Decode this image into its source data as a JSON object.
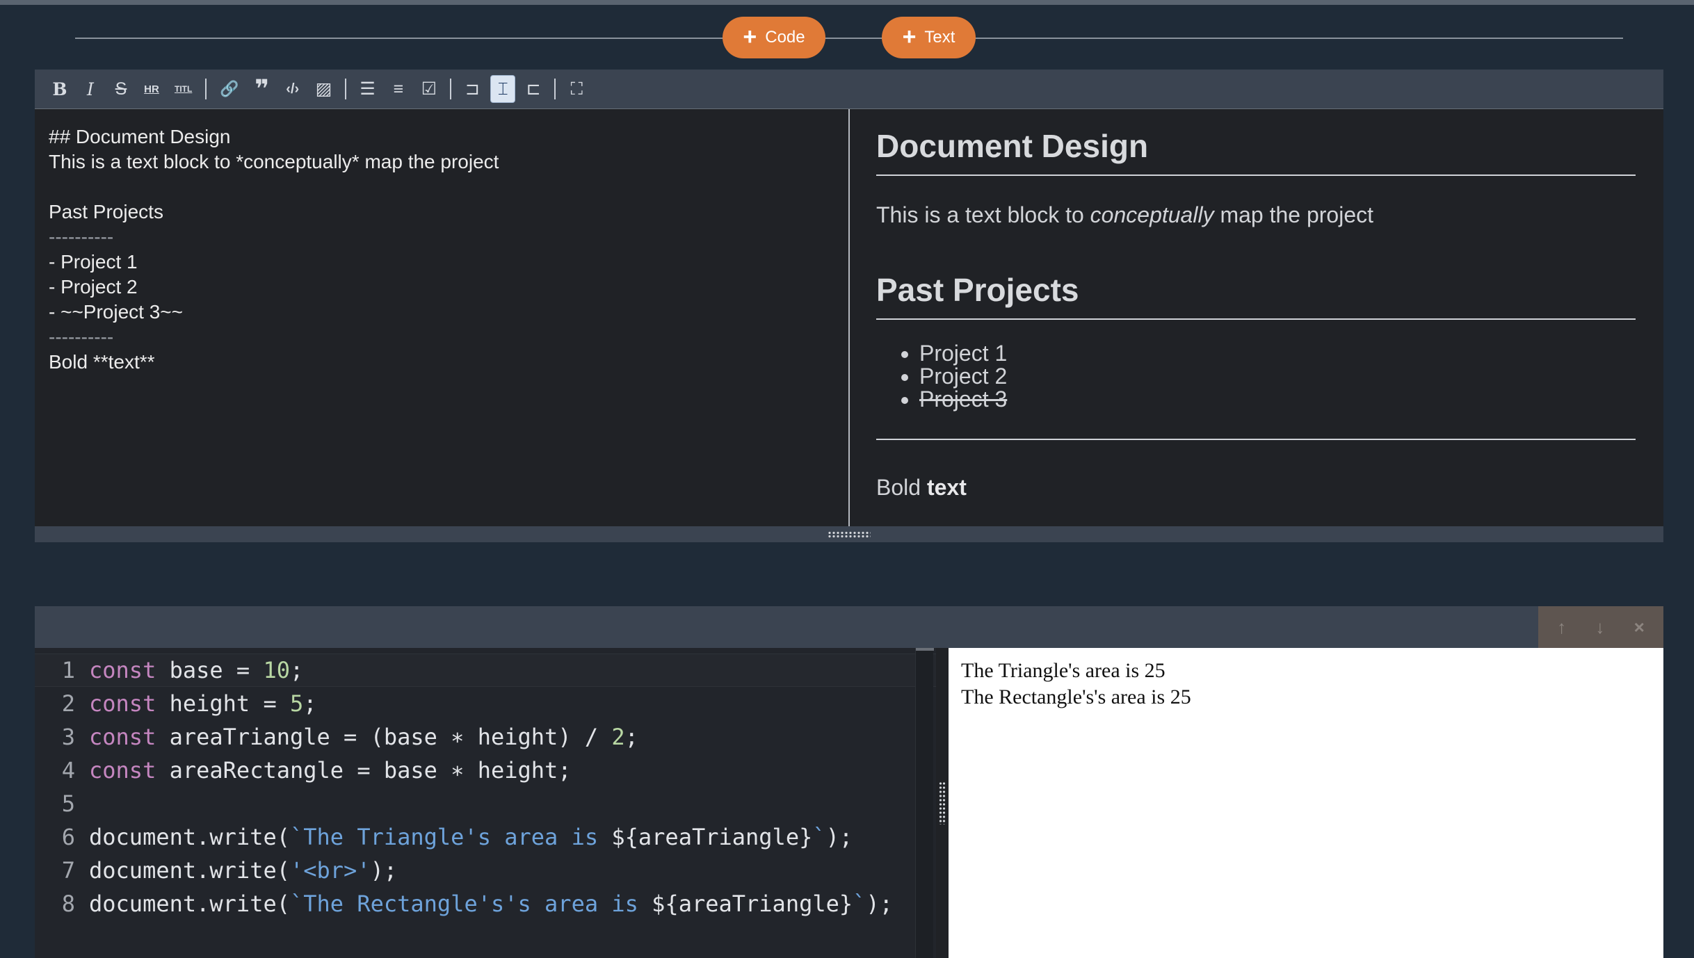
{
  "add_bar": {
    "code_label": "Code",
    "text_label": "Text"
  },
  "markdown_toolbar": {
    "buttons": [
      {
        "name": "bold",
        "glyph": "B"
      },
      {
        "name": "italic",
        "glyph": "I"
      },
      {
        "name": "strikethrough",
        "glyph": "S"
      },
      {
        "name": "horizontal-rule",
        "glyph": "HR"
      },
      {
        "name": "title",
        "glyph": "TITL"
      },
      {
        "name": "link",
        "glyph": "🔗"
      },
      {
        "name": "blockquote",
        "glyph": "❞"
      },
      {
        "name": "code",
        "glyph": "‹/›"
      },
      {
        "name": "image",
        "glyph": "▨"
      },
      {
        "name": "unordered-list",
        "glyph": "☰"
      },
      {
        "name": "ordered-list",
        "glyph": "≡"
      },
      {
        "name": "task-list",
        "glyph": "☑"
      },
      {
        "name": "editor-only",
        "glyph": "⊐"
      },
      {
        "name": "split-view",
        "glyph": "⌶"
      },
      {
        "name": "preview-only",
        "glyph": "⊏"
      },
      {
        "name": "fullscreen",
        "glyph": "⛶"
      }
    ],
    "active": "split-view"
  },
  "markdown_source": {
    "lines": [
      "## Document Design",
      "This is a text block to *conceptually* map the project",
      "",
      "Past Projects",
      "----------",
      "- Project 1",
      "- Project 2",
      "- ~~Project 3~~",
      "----------",
      "Bold **text**"
    ]
  },
  "markdown_preview": {
    "heading": "Document Design",
    "para_before": "This is a text block to ",
    "para_em": "conceptually",
    "para_after": " map the project",
    "subheading": "Past Projects",
    "list": [
      "Project 1",
      "Project 2",
      "Project 3"
    ],
    "bold_prefix": "Bold ",
    "bold_text": "text"
  },
  "code_cell": {
    "controls": {
      "up": "↑",
      "down": "↓",
      "close": "×"
    },
    "line_numbers": [
      "1",
      "2",
      "3",
      "4",
      "5",
      "6",
      "7",
      "8"
    ],
    "line1": {
      "kw": "const",
      "name": " base = ",
      "num": "10",
      "end": ";"
    },
    "line2": {
      "kw": "const",
      "name": " height = ",
      "num": "5",
      "end": ";"
    },
    "line3": {
      "kw": "const",
      "name": " areaTriangle = (base ∗ height) / ",
      "num": "2",
      "end": ";"
    },
    "line4": {
      "kw": "const",
      "name": " areaRectangle = base ∗ height;"
    },
    "line6": {
      "pre": "document.write(",
      "str": "`The Triangle's area is ",
      "interp": "${areaTriangle}",
      "str_end": "`",
      "end": ");"
    },
    "line7": {
      "pre": "document.write(",
      "str": "'<br>'",
      "end": ");"
    },
    "line8": {
      "pre": "document.write(",
      "str": "`The Rectangle's's area is ",
      "interp": "${areaTriangle}",
      "str_end": "`",
      "end": ");"
    }
  },
  "output": {
    "lines": [
      "The Triangle's area is 25",
      "The Rectangle's's area is 25"
    ]
  },
  "colors": {
    "accent_button": "#e07a37",
    "background": "#1f2b38",
    "keyword": "#c586c0",
    "string": "#6ea3db",
    "number": "#b8d7a3"
  }
}
